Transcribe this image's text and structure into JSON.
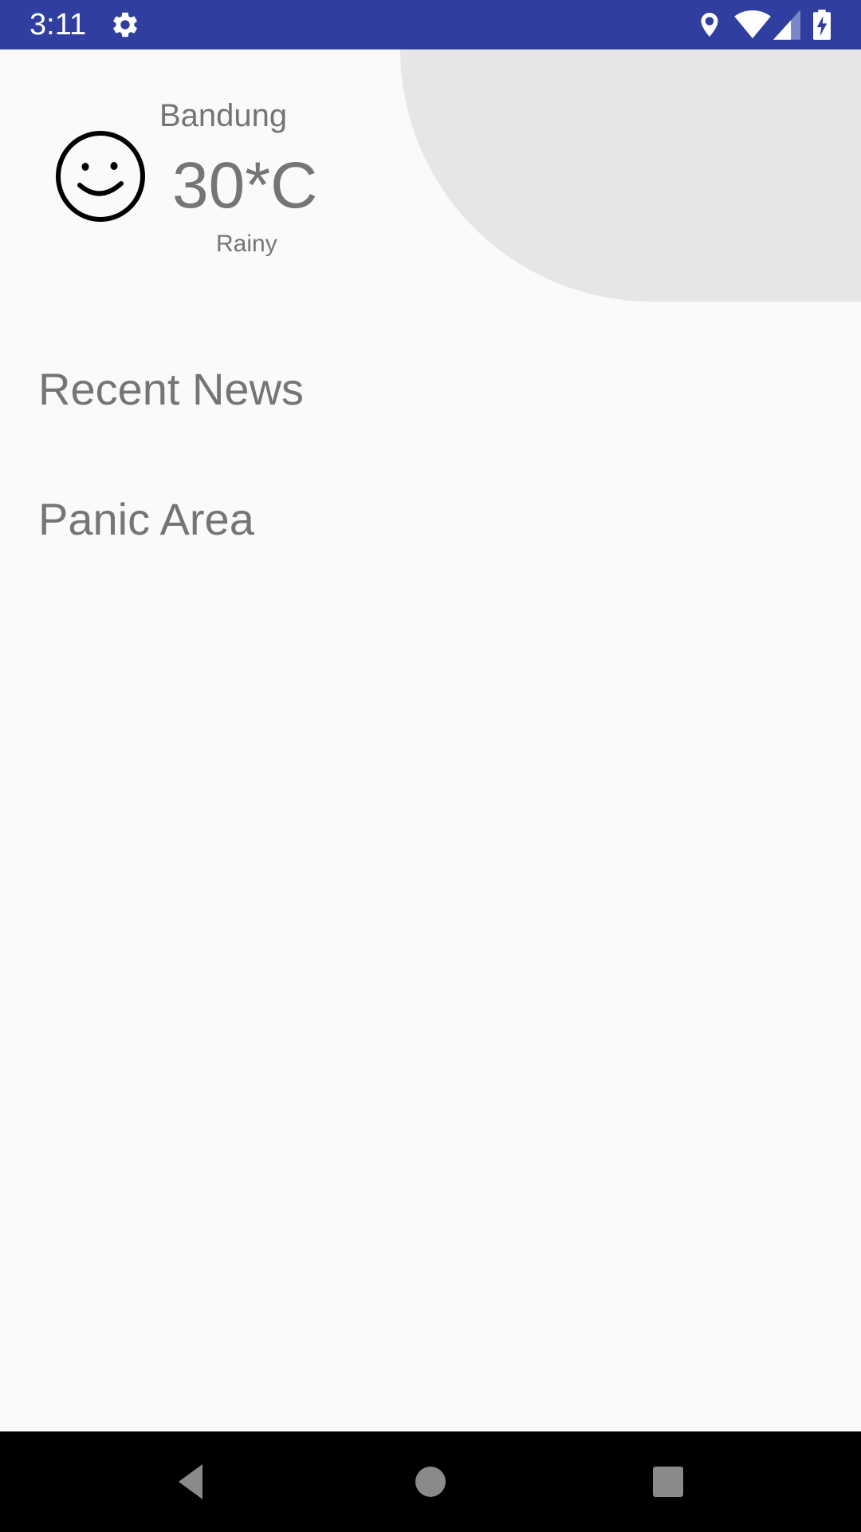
{
  "status_bar": {
    "time": "3:11",
    "background_color": "#303f9f",
    "icons": [
      "settings-icon",
      "location-icon",
      "wifi-icon",
      "signal-icon",
      "battery-charging-icon"
    ]
  },
  "weather": {
    "icon": "smiley-face-icon",
    "city": "Bandung",
    "temperature": "30*C",
    "condition": "Rainy"
  },
  "menu": {
    "items": [
      {
        "label": "Recent News"
      },
      {
        "label": "Panic Area"
      }
    ]
  },
  "navigation_bar": {
    "buttons": [
      "back-icon",
      "home-icon",
      "recents-icon"
    ]
  }
}
